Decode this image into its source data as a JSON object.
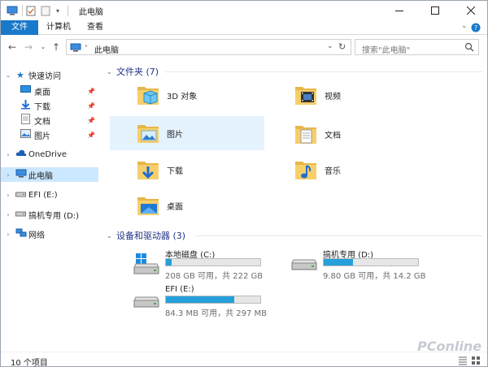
{
  "window": {
    "title": "此电脑",
    "controls": [
      "minimize",
      "maximize",
      "close"
    ]
  },
  "ribbon": {
    "tabs": [
      "文件",
      "计算机",
      "查看"
    ],
    "right_icons": [
      "chevron-down-icon",
      "help-icon"
    ]
  },
  "address": {
    "nav_buttons": [
      "back-icon",
      "forward-icon",
      "recent-icon",
      "up-icon"
    ],
    "path": "此电脑",
    "search_placeholder": "搜索\"此电脑\""
  },
  "nav": {
    "quick_access": "快速访问",
    "quick_items": [
      "桌面",
      "下载",
      "文档",
      "图片"
    ],
    "onedrive": "OneDrive",
    "this_pc": "此电脑",
    "drive_efi": "EFI (E:)",
    "drive_d": "搞机专用 (D:)",
    "network": "网络"
  },
  "content": {
    "folders_group": "文件夹 (7)",
    "folders": [
      "3D 对象",
      "视频",
      "图片",
      "文档",
      "下载",
      "音乐",
      "桌面"
    ],
    "drives_group": "设备和驱动器 (3)",
    "drives": [
      {
        "name": "本地磁盘 (C:)",
        "space": "208 GB 可用，共 222 GB",
        "used": 0.06
      },
      {
        "name": "搞机专用 (D:)",
        "space": "9.80 GB 可用，共 14.2 GB",
        "used": 0.31
      },
      {
        "name": "EFI (E:)",
        "space": "84.3 MB 可用，共 297 MB",
        "used": 0.72
      }
    ]
  },
  "status": {
    "text": "10 个项目"
  },
  "watermark": "PConline",
  "colors": {
    "accent": "#1979ca",
    "bar": "#26a0da",
    "group_title": "#1e3287",
    "selection": "#cce8ff"
  }
}
